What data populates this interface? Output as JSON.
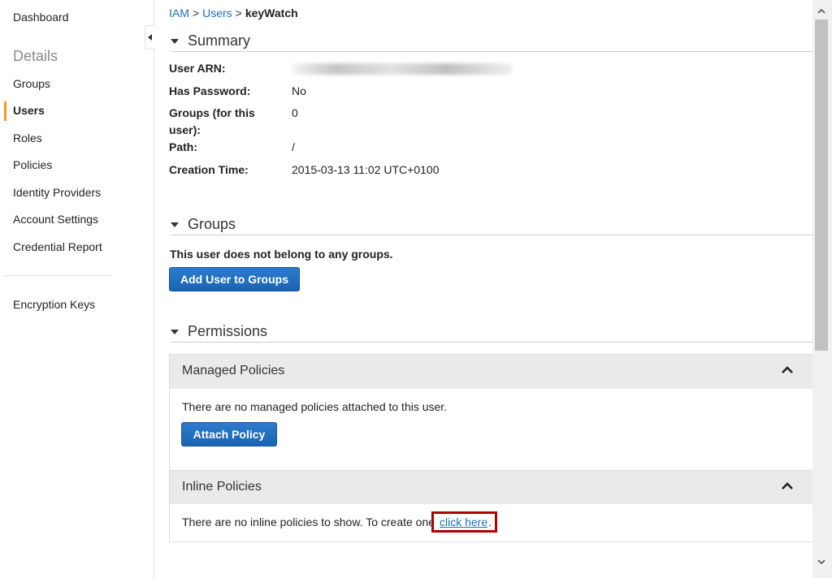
{
  "sidebar": {
    "dashboard": "Dashboard",
    "heading": "Details",
    "items": [
      "Groups",
      "Users",
      "Roles",
      "Policies",
      "Identity Providers",
      "Account Settings",
      "Credential Report"
    ],
    "active_item": "Users",
    "encryption_keys": "Encryption Keys",
    "accent_color": "#f7981d"
  },
  "breadcrumb": {
    "root": "IAM",
    "separator": ">",
    "users": "Users",
    "current": "keyWatch"
  },
  "summary": {
    "title": "Summary",
    "user_arn_label": "User ARN:",
    "has_password_label": "Has Password:",
    "has_password_value": "No",
    "groups_label": "Groups (for this user):",
    "groups_value": "0",
    "path_label": "Path:",
    "path_value": "/",
    "creation_time_label": "Creation Time:",
    "creation_time_value": "2015-03-13 11:02 UTC+0100"
  },
  "groups": {
    "title": "Groups",
    "message": "This user does not belong to any groups.",
    "add_button": "Add User to Groups"
  },
  "permissions": {
    "title": "Permissions",
    "managed": {
      "title": "Managed Policies",
      "message": "There are no managed policies attached to this user.",
      "attach_button": "Attach Policy"
    },
    "inline": {
      "title": "Inline Policies",
      "message": "There are no inline policies to show. To create one",
      "link": "click here",
      "period": "."
    }
  },
  "colors": {
    "link": "#1b6fb5",
    "button": "#1a63b3",
    "highlight": "#b00000"
  }
}
